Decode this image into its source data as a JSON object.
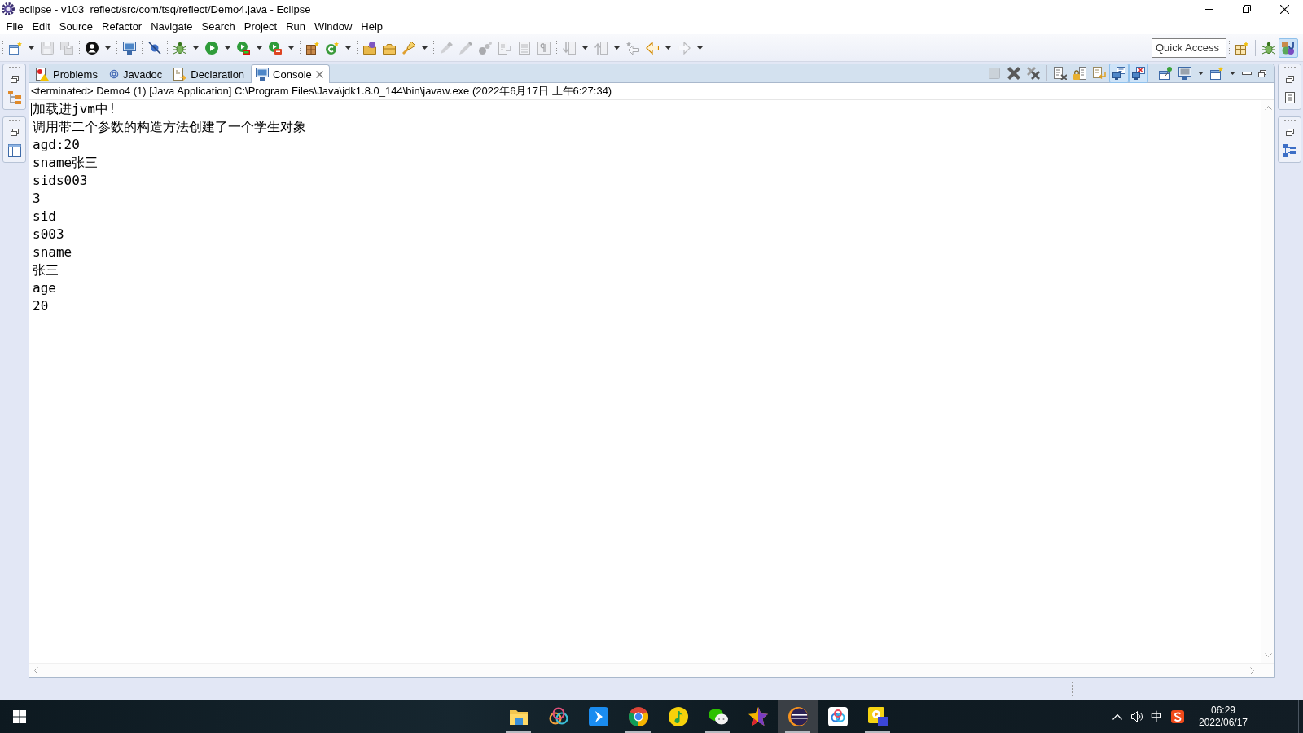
{
  "window": {
    "title": "eclipse - v103_reflect/src/com/tsq/reflect/Demo4.java - Eclipse"
  },
  "menu_bar": [
    "File",
    "Edit",
    "Source",
    "Refactor",
    "Navigate",
    "Search",
    "Project",
    "Run",
    "Window",
    "Help"
  ],
  "toolbar": {
    "groups": [
      {
        "items": [
          {
            "kind": "new",
            "dropdown": true,
            "disabled": false
          },
          {
            "kind": "save",
            "dropdown": false,
            "disabled": true
          },
          {
            "kind": "save-all",
            "dropdown": false,
            "disabled": true
          }
        ]
      },
      {
        "items": [
          {
            "kind": "person",
            "dropdown": true,
            "disabled": false
          }
        ]
      },
      {
        "items": [
          {
            "kind": "monitor",
            "dropdown": false,
            "disabled": false
          }
        ]
      },
      {
        "items": [
          {
            "kind": "skip-breakpoints",
            "dropdown": false,
            "disabled": false
          }
        ]
      },
      {
        "items": [
          {
            "kind": "debug",
            "dropdown": true,
            "disabled": false
          },
          {
            "kind": "run",
            "dropdown": true,
            "disabled": false
          },
          {
            "kind": "coverage",
            "dropdown": true,
            "disabled": false
          },
          {
            "kind": "external-tools",
            "dropdown": true,
            "disabled": false
          }
        ]
      },
      {
        "items": [
          {
            "kind": "new-package",
            "dropdown": false,
            "disabled": false
          },
          {
            "kind": "new-class",
            "dropdown": true,
            "disabled": false
          }
        ]
      },
      {
        "items": [
          {
            "kind": "open-type",
            "dropdown": false,
            "disabled": false
          },
          {
            "kind": "open-task",
            "dropdown": false,
            "disabled": false
          },
          {
            "kind": "search",
            "dropdown": true,
            "disabled": false
          }
        ]
      },
      {
        "items": [
          {
            "kind": "marker",
            "dropdown": false,
            "disabled": true
          },
          {
            "kind": "pen",
            "dropdown": false,
            "disabled": true
          },
          {
            "kind": "dots",
            "dropdown": false,
            "disabled": true
          },
          {
            "kind": "page-return",
            "dropdown": false,
            "disabled": true
          },
          {
            "kind": "list-page",
            "dropdown": false,
            "disabled": true
          },
          {
            "kind": "pilcrow",
            "dropdown": false,
            "disabled": true
          }
        ]
      },
      {
        "items": [
          {
            "kind": "next-annotation",
            "dropdown": true,
            "disabled": true
          },
          {
            "kind": "previous-annotation",
            "dropdown": true,
            "disabled": true
          },
          {
            "kind": "last-edit",
            "dropdown": false,
            "disabled": true
          },
          {
            "kind": "back",
            "dropdown": true,
            "disabled": false
          },
          {
            "kind": "forward",
            "dropdown": true,
            "disabled": true
          }
        ]
      }
    ],
    "quick_access": {
      "placeholder": "Quick Access"
    },
    "perspectives": [
      {
        "kind": "debug",
        "selected": false
      },
      {
        "kind": "java",
        "selected": true
      }
    ]
  },
  "console_view": {
    "tabs": [
      {
        "kind": "problems",
        "label": "Problems",
        "selected": false
      },
      {
        "kind": "javadoc",
        "label": "Javadoc",
        "selected": false
      },
      {
        "kind": "declaration",
        "label": "Declaration",
        "selected": false
      },
      {
        "kind": "console",
        "label": "Console",
        "selected": true
      }
    ],
    "view_toolbar": {
      "groups": [
        {
          "items": [
            {
              "kind": "terminate",
              "dropdown": false,
              "disabled": true,
              "pressed": false
            },
            {
              "kind": "remove-launch",
              "dropdown": false,
              "disabled": false,
              "pressed": false
            },
            {
              "kind": "remove-all",
              "dropdown": false,
              "disabled": false,
              "pressed": false
            }
          ]
        },
        {
          "items": [
            {
              "kind": "clear",
              "dropdown": false,
              "disabled": false,
              "pressed": false
            },
            {
              "kind": "scroll-lock",
              "dropdown": false,
              "disabled": false,
              "pressed": false
            },
            {
              "kind": "word-wrap",
              "dropdown": false,
              "disabled": false,
              "pressed": false
            },
            {
              "kind": "stdout",
              "dropdown": false,
              "disabled": false,
              "pressed": true
            },
            {
              "kind": "stderr",
              "dropdown": false,
              "disabled": false,
              "pressed": true
            }
          ]
        },
        {
          "items": [
            {
              "kind": "pin",
              "dropdown": false,
              "disabled": false,
              "pressed": false
            },
            {
              "kind": "display-console",
              "dropdown": true,
              "disabled": false,
              "pressed": false
            },
            {
              "kind": "open-console",
              "dropdown": true,
              "disabled": false,
              "pressed": false
            }
          ]
        }
      ]
    },
    "description": "<terminated> Demo4 (1) [Java Application] C:\\Program Files\\Java\\jdk1.8.0_144\\bin\\javaw.exe (2022年6月17日 上午6:27:34)",
    "output": [
      "加载进jvm中!",
      "调用带二个参数的构造方法创建了一个学生对象",
      "agd:20",
      "sname张三",
      "sids003",
      "3",
      "sid",
      "s003",
      "sname",
      "张三",
      "age",
      "20"
    ]
  },
  "taskbar": {
    "apps": [
      {
        "kind": "files",
        "running": true,
        "selected": false
      },
      {
        "kind": "rings",
        "running": false,
        "selected": false
      },
      {
        "kind": "arrow",
        "running": false,
        "selected": false
      },
      {
        "kind": "browser",
        "running": true,
        "selected": false
      },
      {
        "kind": "music",
        "running": false,
        "selected": false
      },
      {
        "kind": "chat",
        "running": true,
        "selected": false
      },
      {
        "kind": "star",
        "running": false,
        "selected": false
      },
      {
        "kind": "eclipse",
        "running": true,
        "selected": true
      },
      {
        "kind": "cloud",
        "running": false,
        "selected": false
      },
      {
        "kind": "photos",
        "running": true,
        "selected": false
      }
    ],
    "tray": {
      "input_method": "中",
      "time": "06:29",
      "date": "2022/06/17"
    }
  }
}
